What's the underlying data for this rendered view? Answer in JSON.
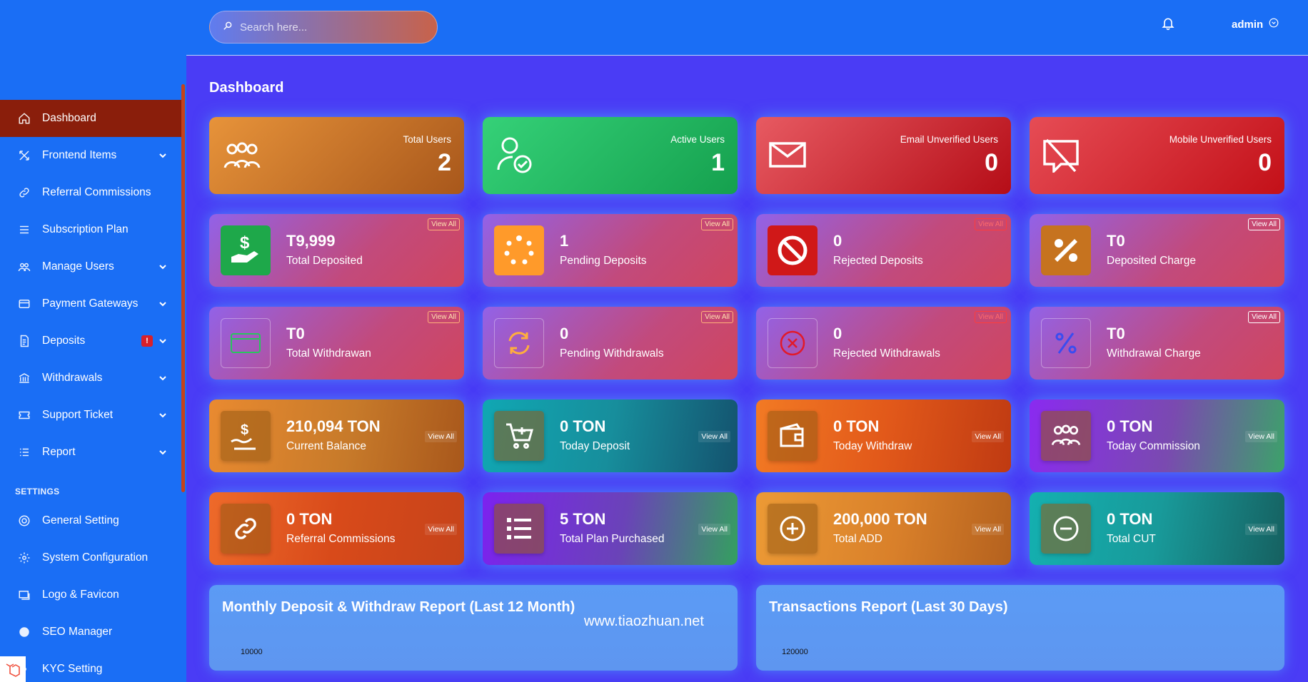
{
  "sidebar": {
    "items": [
      {
        "label": "Dashboard",
        "icon": "home-icon",
        "active": true
      },
      {
        "label": "Frontend Items",
        "icon": "tools-icon",
        "chevron": true
      },
      {
        "label": "Referral Commissions",
        "icon": "link-icon"
      },
      {
        "label": "Subscription Plan",
        "icon": "list-icon"
      },
      {
        "label": "Manage Users",
        "icon": "users-icon",
        "chevron": true
      },
      {
        "label": "Payment Gateways",
        "icon": "card-icon",
        "chevron": true
      },
      {
        "label": "Deposits",
        "icon": "invoice-icon",
        "chevron": true,
        "badge": "!"
      },
      {
        "label": "Withdrawals",
        "icon": "bank-icon",
        "chevron": true
      },
      {
        "label": "Support Ticket",
        "icon": "ticket-icon",
        "chevron": true
      },
      {
        "label": "Report",
        "icon": "report-list-icon",
        "chevron": true
      }
    ],
    "settings_title": "SETTINGS",
    "settings_items": [
      {
        "label": "General Setting",
        "icon": "life-ring-icon"
      },
      {
        "label": "System Configuration",
        "icon": "gear-icon"
      },
      {
        "label": "Logo & Favicon",
        "icon": "images-icon"
      },
      {
        "label": "SEO Manager",
        "icon": "globe-icon"
      },
      {
        "label": "KYC Setting",
        "icon": "id-icon"
      }
    ]
  },
  "header": {
    "search_placeholder": "Search here...",
    "user": "admin"
  },
  "page_title": "Dashboard",
  "stats": [
    {
      "label": "Total Users",
      "value": "2"
    },
    {
      "label": "Active Users",
      "value": "1"
    },
    {
      "label": "Email Unverified Users",
      "value": "0"
    },
    {
      "label": "Mobile Unverified Users",
      "value": "0"
    }
  ],
  "deposit_widgets": [
    {
      "amount": "T9,999",
      "label": "Total Deposited",
      "view": "View All"
    },
    {
      "amount": "1",
      "label": "Pending Deposits",
      "view": "View All"
    },
    {
      "amount": "0",
      "label": "Rejected Deposits",
      "view": "View All"
    },
    {
      "amount": "T0",
      "label": "Deposited Charge",
      "view": "View All"
    }
  ],
  "withdraw_widgets": [
    {
      "amount": "T0",
      "label": "Total Withdrawan",
      "view": "View All"
    },
    {
      "amount": "0",
      "label": "Pending Withdrawals",
      "view": "View All"
    },
    {
      "amount": "0",
      "label": "Rejected Withdrawals",
      "view": "View All"
    },
    {
      "amount": "T0",
      "label": "Withdrawal Charge",
      "view": "View All"
    }
  ],
  "balance_widgets": [
    {
      "amount": "210,094 TON",
      "label": "Current Balance",
      "view": "View All"
    },
    {
      "amount": "0 TON",
      "label": "Today Deposit",
      "view": "View All"
    },
    {
      "amount": "0 TON",
      "label": "Today Withdraw",
      "view": "View All"
    },
    {
      "amount": "0 TON",
      "label": "Today Commission",
      "view": "View All"
    }
  ],
  "extra_widgets": [
    {
      "amount": "0 TON",
      "label": "Referral Commissions",
      "view": "View All"
    },
    {
      "amount": "5 TON",
      "label": "Total Plan Purchased",
      "view": "View All"
    },
    {
      "amount": "200,000 TON",
      "label": "Total ADD",
      "view": "View All"
    },
    {
      "amount": "0 TON",
      "label": "Total CUT",
      "view": "View All"
    }
  ],
  "charts": [
    {
      "title": "Monthly Deposit & Withdraw Report (Last 12 Month)",
      "top_tick": "10000"
    },
    {
      "title": "Transactions Report (Last 30 Days)",
      "top_tick": "120000"
    }
  ],
  "watermark": "www.tiaozhuan.net"
}
